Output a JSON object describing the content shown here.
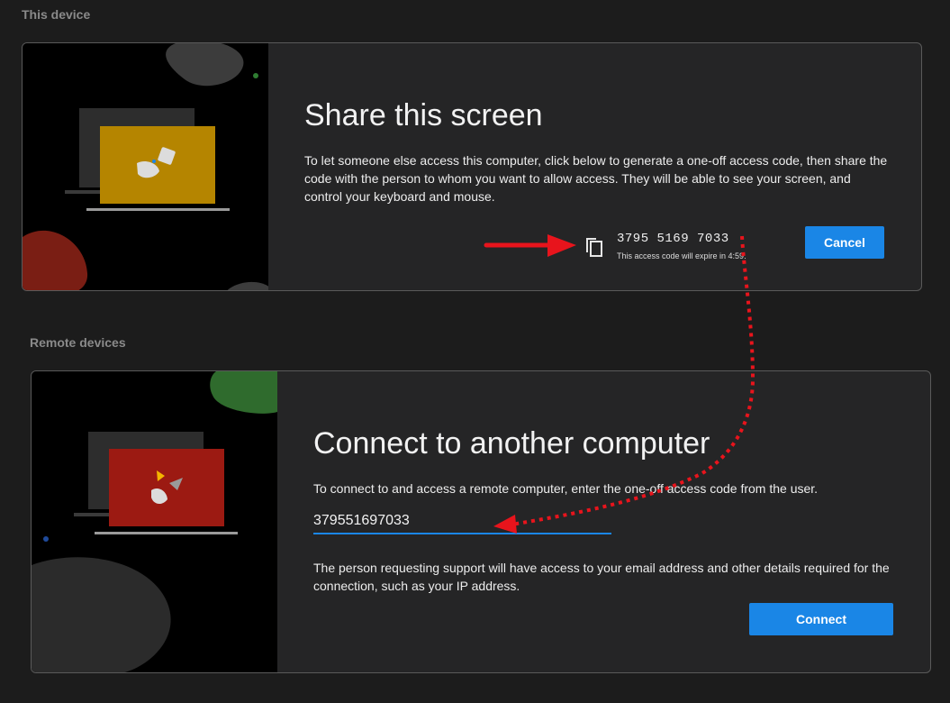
{
  "this_device": {
    "section_label": "This device",
    "title": "Share this screen",
    "description": "To let someone else access this computer, click below to generate a one-off access code, then share the code with the person to whom you want to allow access. They will be able to see your screen, and control your keyboard and mouse.",
    "access_code": "3795  5169  7033",
    "expiry_text": "This access code will expire in 4:59.",
    "cancel_label": "Cancel",
    "copy_icon": "copy-icon"
  },
  "remote_devices": {
    "section_label": "Remote devices",
    "title": "Connect to another computer",
    "instruction": "To connect to and access a remote computer, enter the one-off access code from the user.",
    "code_input_value": "379551697033",
    "privacy_note": "The person requesting support will have access to your email address and other details required for the connection, such as your IP address.",
    "connect_label": "Connect"
  },
  "colors": {
    "accent": "#1a86e6",
    "annotation_red": "#e8141c",
    "share_laptop": "#b58500",
    "connect_laptop": "#9c1a12"
  }
}
